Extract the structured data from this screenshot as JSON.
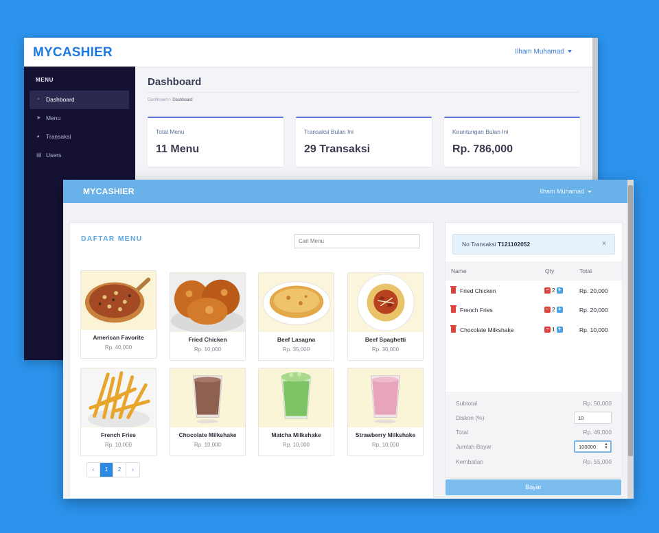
{
  "dashboard": {
    "logo": "MYCASHIER",
    "user": "Ilham Muhamad",
    "menu_header": "MENU",
    "nav": [
      {
        "label": "Dashboard",
        "icon": "dashboard-icon"
      },
      {
        "label": "Menu",
        "icon": "rocket-icon"
      },
      {
        "label": "Transaksi",
        "icon": "pie-chart-icon"
      },
      {
        "label": "Users",
        "icon": "users-icon"
      }
    ],
    "title": "Dashboard",
    "breadcrumb": [
      "Dashboard",
      "Dashboard"
    ],
    "cards": [
      {
        "label": "Total Menu",
        "value": "11 Menu"
      },
      {
        "label": "Transaksi Bulan Ini",
        "value": "29 Transaksi"
      },
      {
        "label": "Keuntungan Bulan Ini",
        "value": "Rp. 786,000"
      }
    ]
  },
  "pos": {
    "logo": "MYCASHIER",
    "user": "Ilham Muhamad",
    "menu_title": "DAFTAR MENU",
    "search_placeholder": "Cari Menu",
    "items": [
      {
        "name": "American Favorite",
        "price": "Rp. 40,000",
        "image": "pizza"
      },
      {
        "name": "Fried Chicken",
        "price": "Rp. 10,000",
        "image": "fried-chicken"
      },
      {
        "name": "Beef Lasagna",
        "price": "Rp. 35,000",
        "image": "lasagna"
      },
      {
        "name": "Beef Spaghetti",
        "price": "Rp. 30,000",
        "image": "spaghetti"
      },
      {
        "name": "French Fries",
        "price": "Rp. 10,000",
        "image": "fries"
      },
      {
        "name": "Chocolate Milkshake",
        "price": "Rp. 10,000",
        "image": "chocolate-milkshake"
      },
      {
        "name": "Matcha Milkshake",
        "price": "Rp. 10,000",
        "image": "matcha-milkshake"
      },
      {
        "name": "Strawberry Milkshake",
        "price": "Rp. 10,000",
        "image": "strawberry-milkshake"
      }
    ],
    "pagination": [
      "‹",
      "1",
      "2",
      "›"
    ],
    "transaction": {
      "label": "No Transaksi",
      "number": "T121102052",
      "close": "×"
    },
    "order_headers": {
      "name": "Name",
      "qty": "Qty",
      "total": "Total"
    },
    "order_rows": [
      {
        "name": "Fried Chicken",
        "qty": "2",
        "total": "Rp. 20,000"
      },
      {
        "name": "French Fries",
        "qty": "2",
        "total": "Rp. 20,000"
      },
      {
        "name": "Chocolate Milkshake",
        "qty": "1",
        "total": "Rp. 10,000"
      }
    ],
    "summary": {
      "subtotal_label": "Subtotal",
      "subtotal": "Rp. 50,000",
      "discount_label": "Diskon (%)",
      "discount": "10",
      "total_label": "Total",
      "total": "Rp. 45,000",
      "paid_label": "Jumlah Bayar",
      "paid": "100000",
      "change_label": "Kembalian",
      "change": "Rp. 55,000"
    },
    "pay_button": "Bayar"
  }
}
